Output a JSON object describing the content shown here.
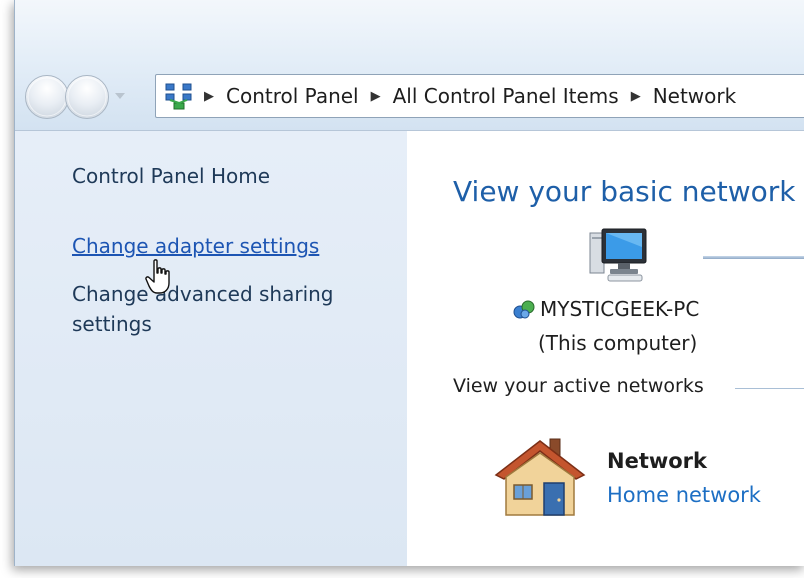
{
  "breadcrumb": {
    "items": [
      "Control Panel",
      "All Control Panel Items",
      "Network"
    ],
    "separator": "▶"
  },
  "left_pane": {
    "home": "Control Panel Home",
    "change_adapter": "Change adapter settings",
    "change_sharing": "Change advanced sharing settings"
  },
  "main": {
    "title": "View your basic network",
    "computer_name": "MYSTICGEEK-PC",
    "computer_sub": "(This computer)",
    "active_networks_label": "View your active networks",
    "network_name": "Network",
    "network_type": "Home network"
  },
  "colors": {
    "link_blue": "#1d55b3",
    "title_blue": "#1e5fa8",
    "pane_bg": "#dce7f3"
  },
  "icons": [
    "back-icon",
    "forward-icon",
    "network-places-icon",
    "computer-icon",
    "globe-network-icon",
    "house-icon",
    "hand-cursor-icon"
  ]
}
